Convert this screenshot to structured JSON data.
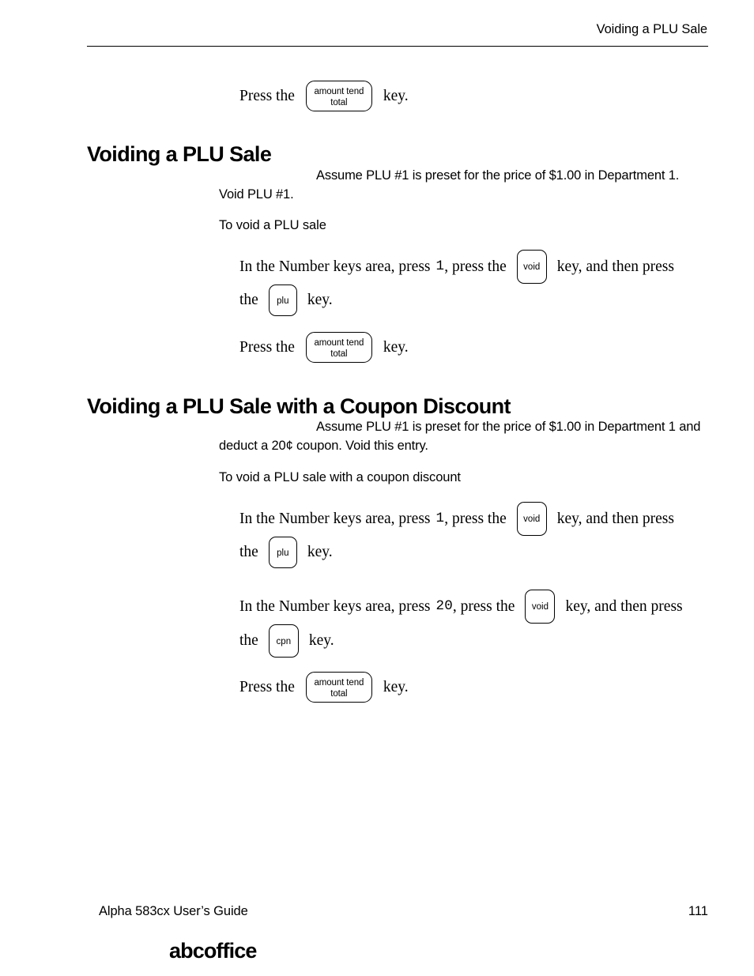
{
  "document": {
    "running_header": "Voiding a PLU Sale",
    "footer_left": "Alpha 583cx  User’s Guide",
    "page_number": "111",
    "logo": "abcoffice"
  },
  "keys": {
    "amount_tend_line1": "amount tend",
    "amount_tend_line2": "total",
    "void": "void",
    "plu": "plu",
    "cpn": "cpn"
  },
  "intro_step": {
    "text_before": "Press the",
    "text_after": "key."
  },
  "section1": {
    "heading": "Voiding a PLU Sale",
    "paragraph": "Assume PLU #1 is preset for the price of $1.00 in Department 1. Void PLU #1.",
    "subheading": "To void a PLU sale",
    "steps": [
      {
        "part1": "In the Number keys area, press",
        "number": "1",
        "part2": ", press the",
        "part3": "key, and then press",
        "part4": "the",
        "part5": "key."
      },
      {
        "text_before": "Press the",
        "text_after": "key."
      }
    ]
  },
  "section2": {
    "heading": "Voiding a PLU Sale with a Coupon Discount",
    "paragraph": "Assume PLU #1 is preset for the price of $1.00 in Department 1 and deduct a 20¢ coupon. Void this entry.",
    "subheading": "To void a PLU sale with a coupon discount",
    "steps": [
      {
        "part1": "In the Number keys area, press",
        "number": "1",
        "part2": ", press the",
        "part3": "key, and then press",
        "part4": "the",
        "part5": "key."
      },
      {
        "part1": "In the Number keys area, press",
        "number": "20",
        "part2": ", press the",
        "part3": "key, and then press",
        "part4": "the",
        "part5": "key."
      },
      {
        "text_before": "Press the",
        "text_after": "key."
      }
    ]
  }
}
